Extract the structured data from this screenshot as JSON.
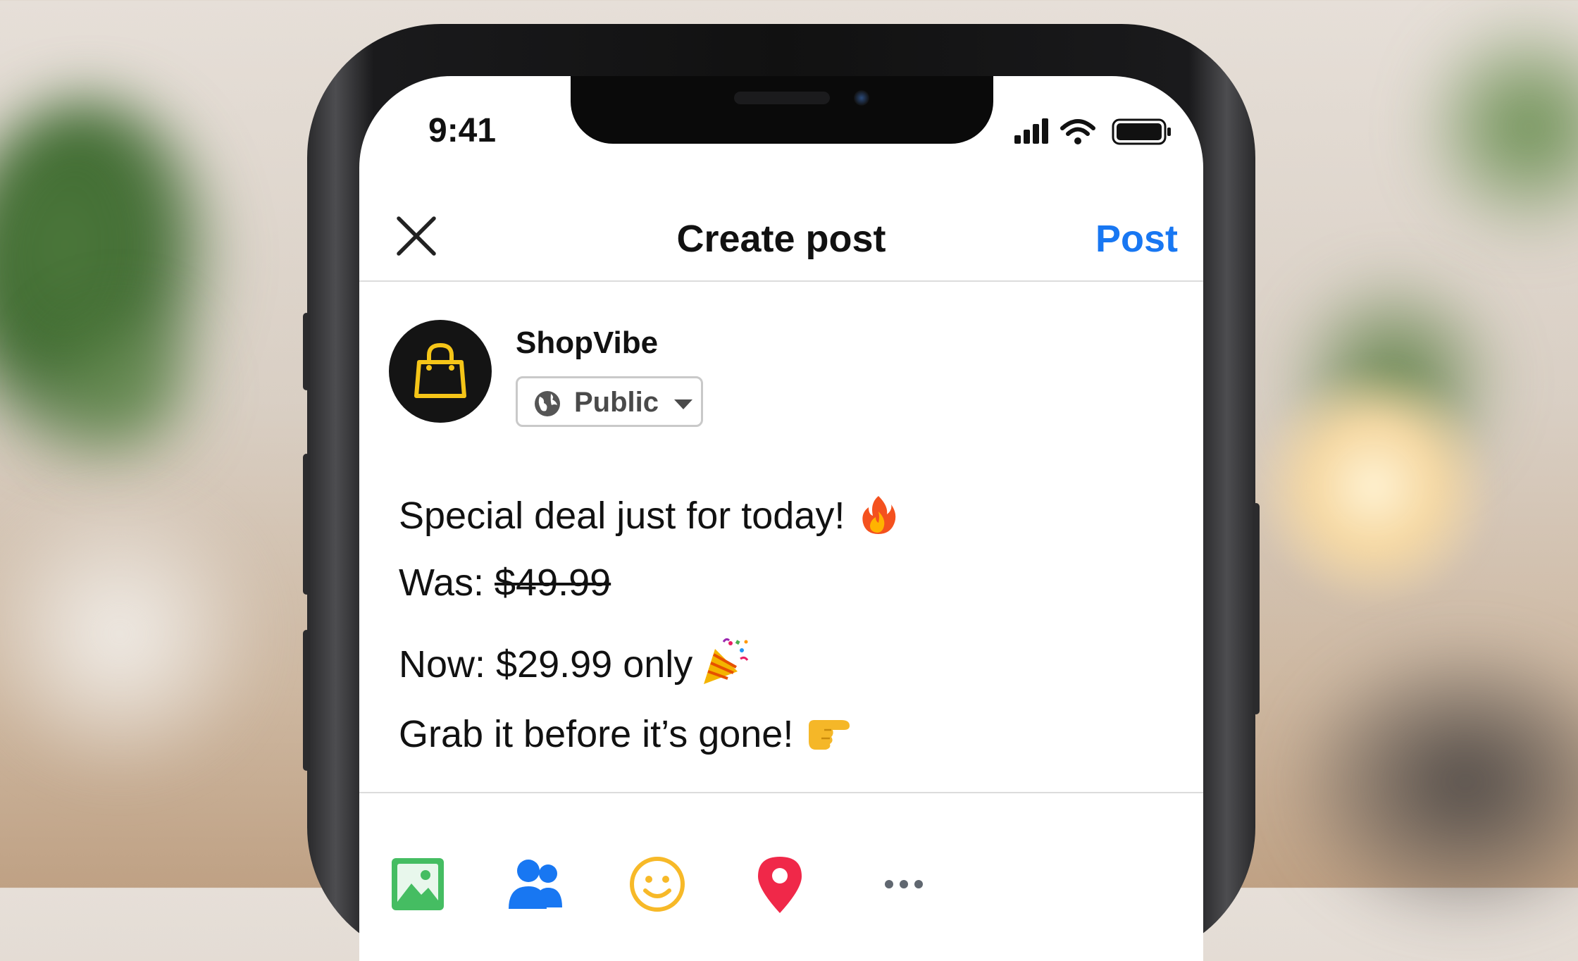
{
  "status_bar": {
    "time": "9:41"
  },
  "header": {
    "title": "Create post",
    "post_label": "Post"
  },
  "account": {
    "name": "ShopVibe",
    "audience": "Public"
  },
  "post": {
    "line1": "Special deal just for today!",
    "line2_prefix": "Was:",
    "line2_old_price": "$49.99",
    "line3": "Now: $29.99 only",
    "line4": "Grab it before it’s gone!"
  },
  "icons": {
    "line1": "fire-emoji",
    "line3": "party-popper-emoji",
    "line4": "pointing-right-emoji",
    "toolbar": [
      "photo-icon",
      "tag-people-icon",
      "feeling-icon",
      "location-icon",
      "more-icon"
    ]
  },
  "colors": {
    "accent": "#1877f2",
    "avatar_bg": "#141414",
    "brand_icon": "#f5c518"
  }
}
